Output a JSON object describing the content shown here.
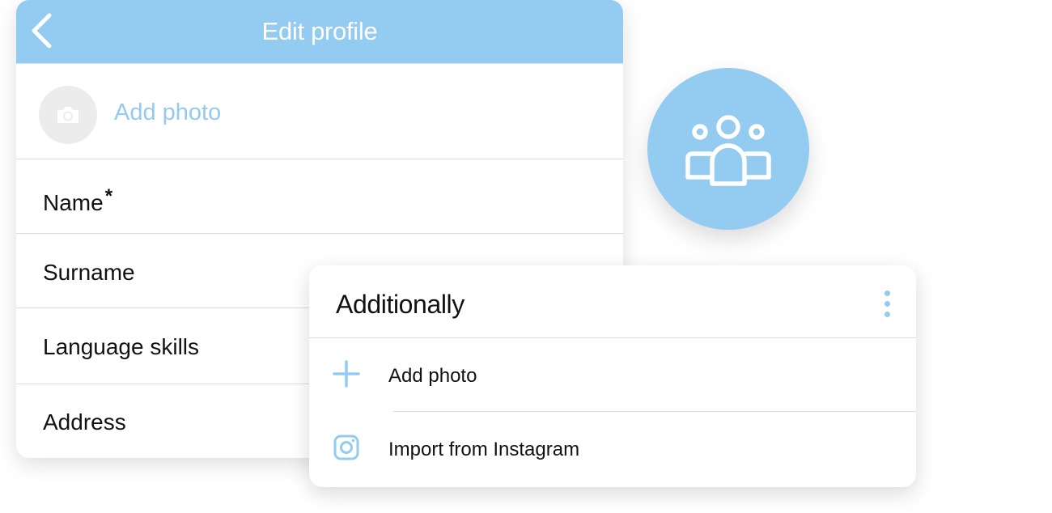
{
  "profile": {
    "title": "Edit profile",
    "add_photo_label": "Add photo",
    "fields": [
      {
        "label": "Name",
        "required_mark": "*"
      },
      {
        "label": "Surname"
      },
      {
        "label": "Language skills"
      },
      {
        "label": "Address"
      }
    ]
  },
  "panel": {
    "title": "Additionally",
    "items": [
      {
        "label": "Add photo",
        "icon": "plus-icon"
      },
      {
        "label": "Import from Instagram",
        "icon": "instagram-icon"
      }
    ]
  },
  "bubble": {
    "icon": "group-icon"
  },
  "colors": {
    "accent": "#93cbf1",
    "header_text": "#ffffff",
    "avatar_bg": "#ececec",
    "text": "#111111",
    "divider": "#dcdcdc"
  }
}
